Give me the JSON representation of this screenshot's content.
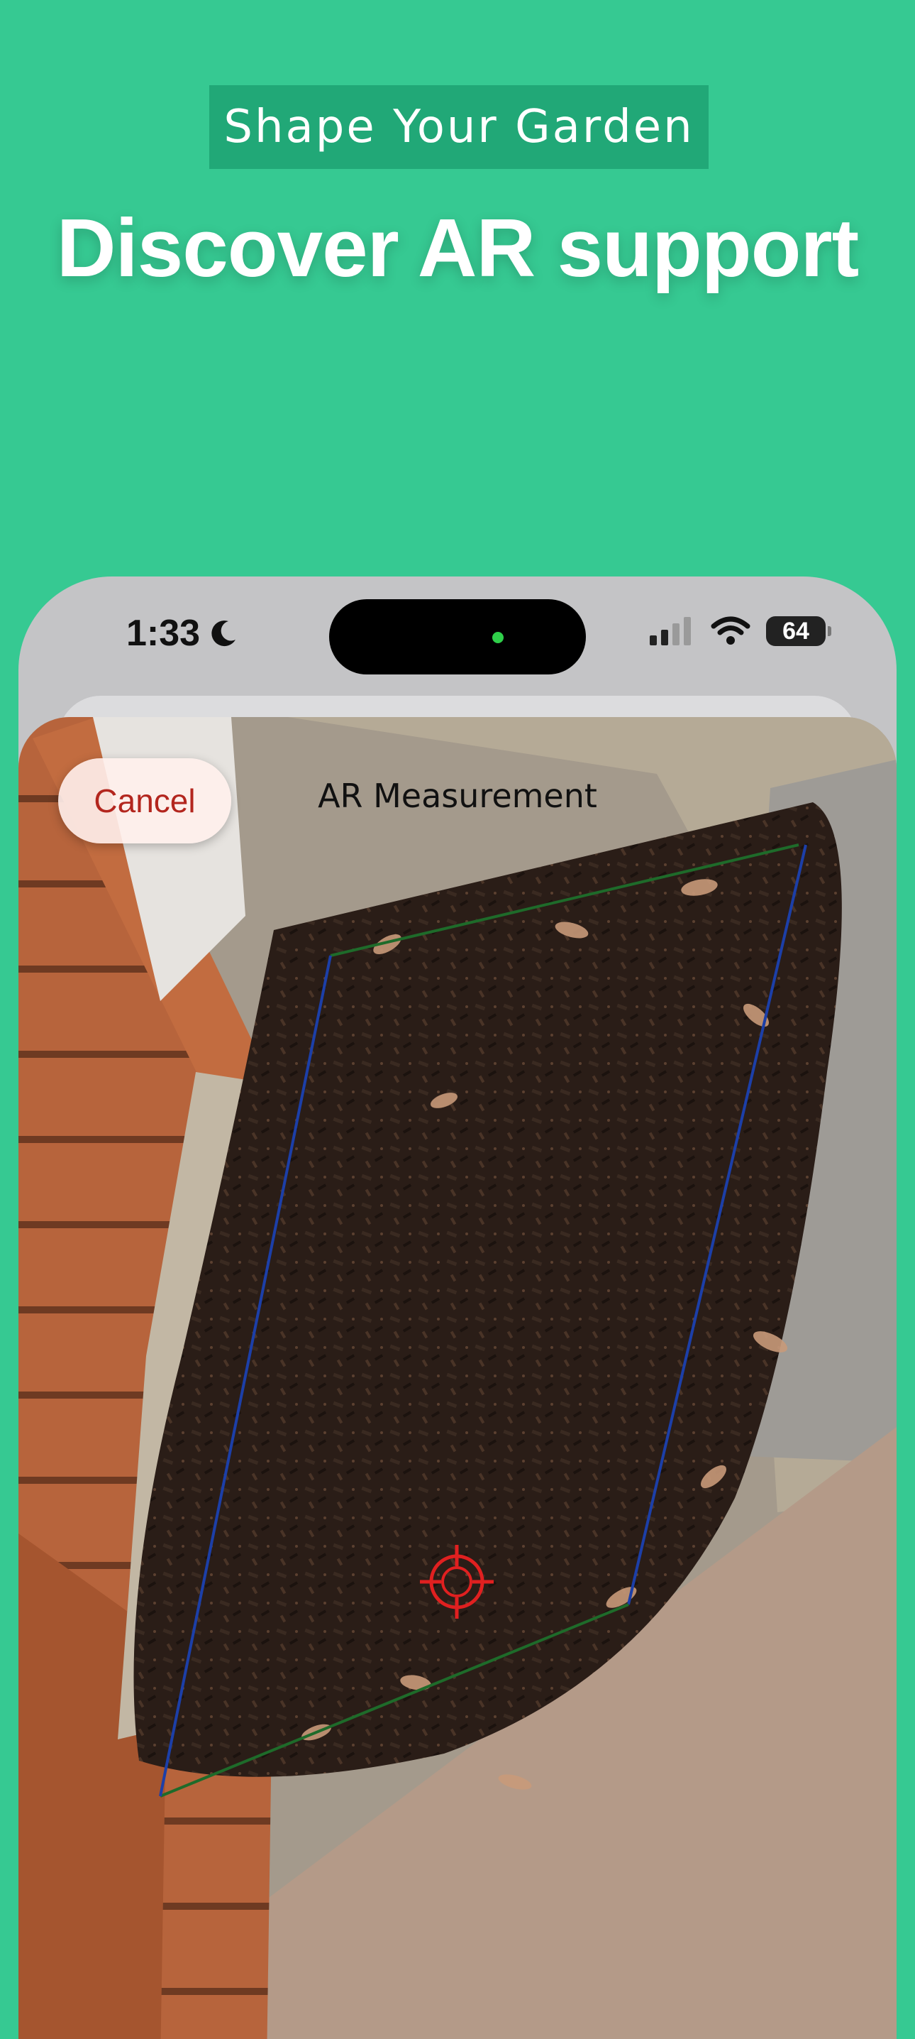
{
  "marketing": {
    "tag": "Shape Your Garden",
    "headline": "Discover AR support"
  },
  "status_bar": {
    "time": "1:33",
    "focus_icon": "moon-icon",
    "signal_icon": "cellular-signal-icon",
    "wifi_icon": "wifi-icon",
    "battery_level": "64"
  },
  "ar_screen": {
    "title": "AR Measurement",
    "cancel_label": "Cancel",
    "crosshair_icon": "crosshair-icon"
  },
  "colors": {
    "background": "#36c992",
    "tag_background": "#21a877",
    "edge_blue": "#1c3fa8",
    "edge_green": "#1e6b2a",
    "crosshair": "#e02020"
  }
}
